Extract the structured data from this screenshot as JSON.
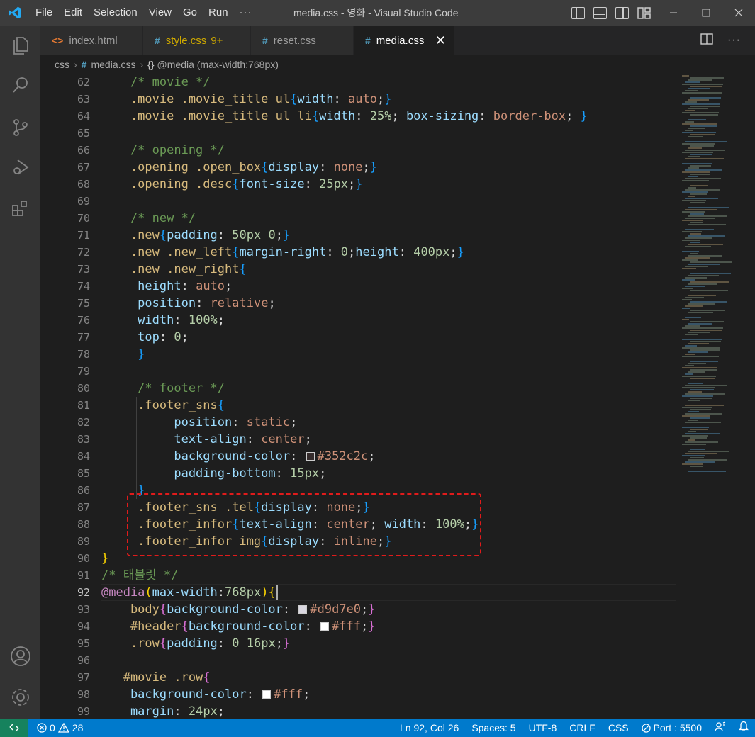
{
  "window": {
    "title": "media.css - 영화 - Visual Studio Code",
    "menu": [
      "File",
      "Edit",
      "Selection",
      "View",
      "Go",
      "Run",
      "···"
    ]
  },
  "tabs": [
    {
      "label": "index.html",
      "icon": "<>",
      "badge": "",
      "active": false
    },
    {
      "label": "style.css",
      "icon": "#",
      "badge": "9+",
      "active": false
    },
    {
      "label": "reset.css",
      "icon": "#",
      "badge": "",
      "active": false
    },
    {
      "label": "media.css",
      "icon": "#",
      "badge": "",
      "active": true
    }
  ],
  "breadcrumb": {
    "folder": "css",
    "file": "media.css",
    "symbol": "@media (max-width:768px)"
  },
  "editor": {
    "line_numbers": [
      "62",
      "63",
      "64",
      "65",
      "66",
      "67",
      "68",
      "69",
      "70",
      "71",
      "72",
      "73",
      "74",
      "75",
      "76",
      "77",
      "78",
      "79",
      "80",
      "81",
      "82",
      "83",
      "84",
      "85",
      "86",
      "87",
      "88",
      "89",
      "90",
      "91",
      "92",
      "93",
      "94",
      "95",
      "96",
      "97",
      "98",
      "99"
    ],
    "current_line": "92",
    "code_lines": [
      [
        {
          "c": "t-comment",
          "t": "    /* movie */"
        }
      ],
      [
        {
          "c": "t-sel",
          "t": "    .movie .movie_title ul"
        },
        {
          "c": "t-b3",
          "t": "{"
        },
        {
          "c": "t-prop",
          "t": "width"
        },
        {
          "c": "t-punc",
          "t": ": "
        },
        {
          "c": "t-val",
          "t": "auto"
        },
        {
          "c": "t-punc",
          "t": ";"
        },
        {
          "c": "t-b3",
          "t": "}"
        }
      ],
      [
        {
          "c": "t-sel",
          "t": "    .movie .movie_title ul li"
        },
        {
          "c": "t-b3",
          "t": "{"
        },
        {
          "c": "t-prop",
          "t": "width"
        },
        {
          "c": "t-punc",
          "t": ": "
        },
        {
          "c": "t-num",
          "t": "25%"
        },
        {
          "c": "t-punc",
          "t": "; "
        },
        {
          "c": "t-prop",
          "t": "box-sizing"
        },
        {
          "c": "t-punc",
          "t": ": "
        },
        {
          "c": "t-val",
          "t": "border-box"
        },
        {
          "c": "t-punc",
          "t": "; "
        },
        {
          "c": "t-b3",
          "t": "}"
        }
      ],
      [],
      [
        {
          "c": "t-comment",
          "t": "    /* opening */"
        }
      ],
      [
        {
          "c": "t-sel",
          "t": "    .opening .open_box"
        },
        {
          "c": "t-b3",
          "t": "{"
        },
        {
          "c": "t-prop",
          "t": "display"
        },
        {
          "c": "t-punc",
          "t": ": "
        },
        {
          "c": "t-val",
          "t": "none"
        },
        {
          "c": "t-punc",
          "t": ";"
        },
        {
          "c": "t-b3",
          "t": "}"
        }
      ],
      [
        {
          "c": "t-sel",
          "t": "    .opening .desc"
        },
        {
          "c": "t-b3",
          "t": "{"
        },
        {
          "c": "t-prop",
          "t": "font-size"
        },
        {
          "c": "t-punc",
          "t": ": "
        },
        {
          "c": "t-num",
          "t": "25px"
        },
        {
          "c": "t-punc",
          "t": ";"
        },
        {
          "c": "t-b3",
          "t": "}"
        }
      ],
      [],
      [
        {
          "c": "t-comment",
          "t": "    /* new */"
        }
      ],
      [
        {
          "c": "t-sel",
          "t": "    .new"
        },
        {
          "c": "t-b3",
          "t": "{"
        },
        {
          "c": "t-prop",
          "t": "padding"
        },
        {
          "c": "t-punc",
          "t": ": "
        },
        {
          "c": "t-num",
          "t": "50px 0"
        },
        {
          "c": "t-punc",
          "t": ";"
        },
        {
          "c": "t-b3",
          "t": "}"
        }
      ],
      [
        {
          "c": "t-sel",
          "t": "    .new .new_left"
        },
        {
          "c": "t-b3",
          "t": "{"
        },
        {
          "c": "t-prop",
          "t": "margin-right"
        },
        {
          "c": "t-punc",
          "t": ": "
        },
        {
          "c": "t-num",
          "t": "0"
        },
        {
          "c": "t-punc",
          "t": ";"
        },
        {
          "c": "t-prop",
          "t": "height"
        },
        {
          "c": "t-punc",
          "t": ": "
        },
        {
          "c": "t-num",
          "t": "400px"
        },
        {
          "c": "t-punc",
          "t": ";"
        },
        {
          "c": "t-b3",
          "t": "}"
        }
      ],
      [
        {
          "c": "t-sel",
          "t": "    .new .new_right"
        },
        {
          "c": "t-b3",
          "t": "{"
        }
      ],
      [
        {
          "c": "t-prop",
          "t": "     height"
        },
        {
          "c": "t-punc",
          "t": ": "
        },
        {
          "c": "t-val",
          "t": "auto"
        },
        {
          "c": "t-punc",
          "t": ";"
        }
      ],
      [
        {
          "c": "t-prop",
          "t": "     position"
        },
        {
          "c": "t-punc",
          "t": ": "
        },
        {
          "c": "t-val",
          "t": "relative"
        },
        {
          "c": "t-punc",
          "t": ";"
        }
      ],
      [
        {
          "c": "t-prop",
          "t": "     width"
        },
        {
          "c": "t-punc",
          "t": ": "
        },
        {
          "c": "t-num",
          "t": "100%"
        },
        {
          "c": "t-punc",
          "t": ";"
        }
      ],
      [
        {
          "c": "t-prop",
          "t": "     top"
        },
        {
          "c": "t-punc",
          "t": ": "
        },
        {
          "c": "t-num",
          "t": "0"
        },
        {
          "c": "t-punc",
          "t": ";"
        }
      ],
      [
        {
          "c": "t-b3",
          "t": "     }"
        }
      ],
      [],
      [
        {
          "c": "t-comment",
          "t": "     /* footer */"
        }
      ],
      [
        {
          "c": "t-sel",
          "t": "     .footer_sns"
        },
        {
          "c": "t-b3",
          "t": "{"
        }
      ],
      [
        {
          "c": "t-prop",
          "t": "          position"
        },
        {
          "c": "t-punc",
          "t": ": "
        },
        {
          "c": "t-val",
          "t": "static"
        },
        {
          "c": "t-punc",
          "t": ";"
        }
      ],
      [
        {
          "c": "t-prop",
          "t": "          text-align"
        },
        {
          "c": "t-punc",
          "t": ": "
        },
        {
          "c": "t-val",
          "t": "center"
        },
        {
          "c": "t-punc",
          "t": ";"
        }
      ],
      [
        {
          "c": "t-prop",
          "t": "          background-color"
        },
        {
          "c": "t-punc",
          "t": ": "
        },
        {
          "c": "swatch",
          "t": "#352c2c"
        },
        {
          "c": "t-val",
          "t": "#352c2c"
        },
        {
          "c": "t-punc",
          "t": ";"
        }
      ],
      [
        {
          "c": "t-prop",
          "t": "          padding-bottom"
        },
        {
          "c": "t-punc",
          "t": ": "
        },
        {
          "c": "t-num",
          "t": "15px"
        },
        {
          "c": "t-punc",
          "t": ";"
        }
      ],
      [
        {
          "c": "t-b3",
          "t": "     }"
        }
      ],
      [
        {
          "c": "t-sel",
          "t": "     .footer_sns .tel"
        },
        {
          "c": "t-b3",
          "t": "{"
        },
        {
          "c": "t-prop",
          "t": "display"
        },
        {
          "c": "t-punc",
          "t": ": "
        },
        {
          "c": "t-val",
          "t": "none"
        },
        {
          "c": "t-punc",
          "t": ";"
        },
        {
          "c": "t-b3",
          "t": "}"
        }
      ],
      [
        {
          "c": "t-sel",
          "t": "     .footer_infor"
        },
        {
          "c": "t-b3",
          "t": "{"
        },
        {
          "c": "t-prop",
          "t": "text-align"
        },
        {
          "c": "t-punc",
          "t": ": "
        },
        {
          "c": "t-val",
          "t": "center"
        },
        {
          "c": "t-punc",
          "t": "; "
        },
        {
          "c": "t-prop",
          "t": "width"
        },
        {
          "c": "t-punc",
          "t": ": "
        },
        {
          "c": "t-num",
          "t": "100%"
        },
        {
          "c": "t-punc",
          "t": ";"
        },
        {
          "c": "t-b3",
          "t": "}"
        }
      ],
      [
        {
          "c": "t-sel",
          "t": "     .footer_infor img"
        },
        {
          "c": "t-b3",
          "t": "{"
        },
        {
          "c": "t-prop",
          "t": "display"
        },
        {
          "c": "t-punc",
          "t": ": "
        },
        {
          "c": "t-val",
          "t": "inline"
        },
        {
          "c": "t-punc",
          "t": ";"
        },
        {
          "c": "t-b3",
          "t": "}"
        }
      ],
      [
        {
          "c": "t-b1",
          "t": "}"
        }
      ],
      [
        {
          "c": "t-comment",
          "t": "/* 태블릿 */"
        }
      ],
      [
        {
          "c": "t-at",
          "t": "@media"
        },
        {
          "c": "t-b1",
          "t": "("
        },
        {
          "c": "t-prop",
          "t": "max-width"
        },
        {
          "c": "t-punc",
          "t": ":"
        },
        {
          "c": "t-num",
          "t": "768px"
        },
        {
          "c": "t-b1",
          "t": ")"
        },
        {
          "c": "t-b1",
          "t": "{"
        }
      ],
      [
        {
          "c": "t-sel",
          "t": "    body"
        },
        {
          "c": "t-b2",
          "t": "{"
        },
        {
          "c": "t-prop",
          "t": "background-color"
        },
        {
          "c": "t-punc",
          "t": ": "
        },
        {
          "c": "swatch",
          "t": "#d9d7e0"
        },
        {
          "c": "t-val",
          "t": "#d9d7e0"
        },
        {
          "c": "t-punc",
          "t": ";"
        },
        {
          "c": "t-b2",
          "t": "}"
        }
      ],
      [
        {
          "c": "t-sel",
          "t": "    #header"
        },
        {
          "c": "t-b2",
          "t": "{"
        },
        {
          "c": "t-prop",
          "t": "background-color"
        },
        {
          "c": "t-punc",
          "t": ": "
        },
        {
          "c": "swatch",
          "t": "#fff"
        },
        {
          "c": "t-val",
          "t": "#fff"
        },
        {
          "c": "t-punc",
          "t": ";"
        },
        {
          "c": "t-b2",
          "t": "}"
        }
      ],
      [
        {
          "c": "t-sel",
          "t": "    .row"
        },
        {
          "c": "t-b2",
          "t": "{"
        },
        {
          "c": "t-prop",
          "t": "padding"
        },
        {
          "c": "t-punc",
          "t": ": "
        },
        {
          "c": "t-num",
          "t": "0 16px"
        },
        {
          "c": "t-punc",
          "t": ";"
        },
        {
          "c": "t-b2",
          "t": "}"
        }
      ],
      [],
      [
        {
          "c": "t-sel",
          "t": "   #movie .row"
        },
        {
          "c": "t-b2",
          "t": "{"
        }
      ],
      [
        {
          "c": "t-prop",
          "t": "    background-color"
        },
        {
          "c": "t-punc",
          "t": ": "
        },
        {
          "c": "swatch",
          "t": "#fff"
        },
        {
          "c": "t-val",
          "t": "#fff"
        },
        {
          "c": "t-punc",
          "t": ";"
        }
      ],
      [
        {
          "c": "t-prop",
          "t": "    margin"
        },
        {
          "c": "t-punc",
          "t": ": "
        },
        {
          "c": "t-num",
          "t": "24px"
        },
        {
          "c": "t-punc",
          "t": ";"
        }
      ]
    ]
  },
  "statusbar": {
    "errors": "0",
    "warnings": "28",
    "position": "Ln 92, Col 26",
    "spaces": "Spaces: 5",
    "encoding": "UTF-8",
    "eol": "CRLF",
    "language": "CSS",
    "port": "Port : 5500"
  },
  "colors": {
    "accent": "#007acc",
    "highlight_box": "#e01b1b"
  }
}
